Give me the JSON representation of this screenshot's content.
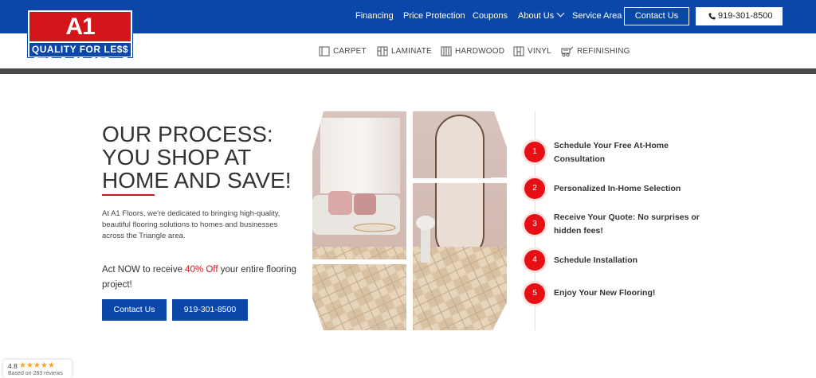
{
  "brand": {
    "logo_top": "A1 FLOORS",
    "logo_bottom": "QUALITY FOR LE$$",
    "primary_blue": "#0a47a9",
    "accent_red": "#d4161c"
  },
  "header": {
    "nav": [
      {
        "label": "Financing"
      },
      {
        "label": "Price Protection"
      },
      {
        "label": "Coupons"
      },
      {
        "label": "About Us"
      },
      {
        "label": "Service Area"
      }
    ],
    "contact_button": "Contact Us",
    "phone_button": "919-301-8500"
  },
  "categories": [
    {
      "label": "CARPET",
      "icon": "carpet-icon"
    },
    {
      "label": "LAMINATE",
      "icon": "laminate-icon"
    },
    {
      "label": "HARDWOOD",
      "icon": "hardwood-icon"
    },
    {
      "label": "VINYL",
      "icon": "vinyl-icon"
    },
    {
      "label": "REFINISHING",
      "icon": "refinishing-icon"
    }
  ],
  "hero": {
    "title_line1": "OUR PROCESS:",
    "title_line2": "YOU SHOP AT",
    "title_line3": "HOME AND SAVE!",
    "description": "At A1 Floors, we're dedicated to bringing high-quality, beautiful flooring solutions to homes and businesses across the Triangle area.",
    "offer_prefix": "Act NOW to receive ",
    "offer_highlight": "40% Off",
    "offer_suffix": " your entire flooring project!",
    "contact_button": "Contact Us",
    "phone_button": "919-301-8500"
  },
  "steps": [
    {
      "number": "1",
      "text": "Schedule Your Free At-Home Consultation"
    },
    {
      "number": "2",
      "text": "Personalized In-Home Selection"
    },
    {
      "number": "3",
      "text": "Receive Your Quote: No surprises or hidden fees!"
    },
    {
      "number": "4",
      "text": "Schedule Installation"
    },
    {
      "number": "5",
      "text": "Enjoy Your New Flooring!"
    }
  ],
  "rating": {
    "score": "4.8",
    "stars": "★★★★★",
    "subtitle": "Based on 283 reviews"
  }
}
